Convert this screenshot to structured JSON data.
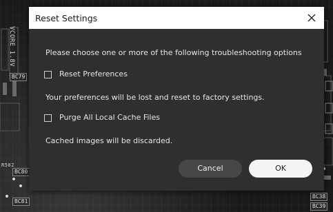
{
  "dialog": {
    "title": "Reset Settings",
    "close_icon": "close-icon",
    "prompt": "Please choose one or more of the following troubleshooting options",
    "options": [
      {
        "label": "Reset Preferences",
        "checked": false,
        "description": "Your preferences will be lost and reset to factory settings."
      },
      {
        "label": "Purge All Local Cache Files",
        "checked": false,
        "description": "Cached images will be discarded."
      }
    ],
    "cancel_label": "Cancel",
    "ok_label": "OK"
  },
  "background": {
    "silkscreen": [
      "VCORE 1.8V",
      "BC79",
      "BC80",
      "R502",
      "BC81",
      "BC38",
      "BC39"
    ]
  },
  "colors": {
    "dialog_bg": "#2f2f2f",
    "titlebar_bg": "#ffffff",
    "cancel_bg": "#474747",
    "ok_bg": "#f5f5f5",
    "text": "#e6e6e6"
  }
}
